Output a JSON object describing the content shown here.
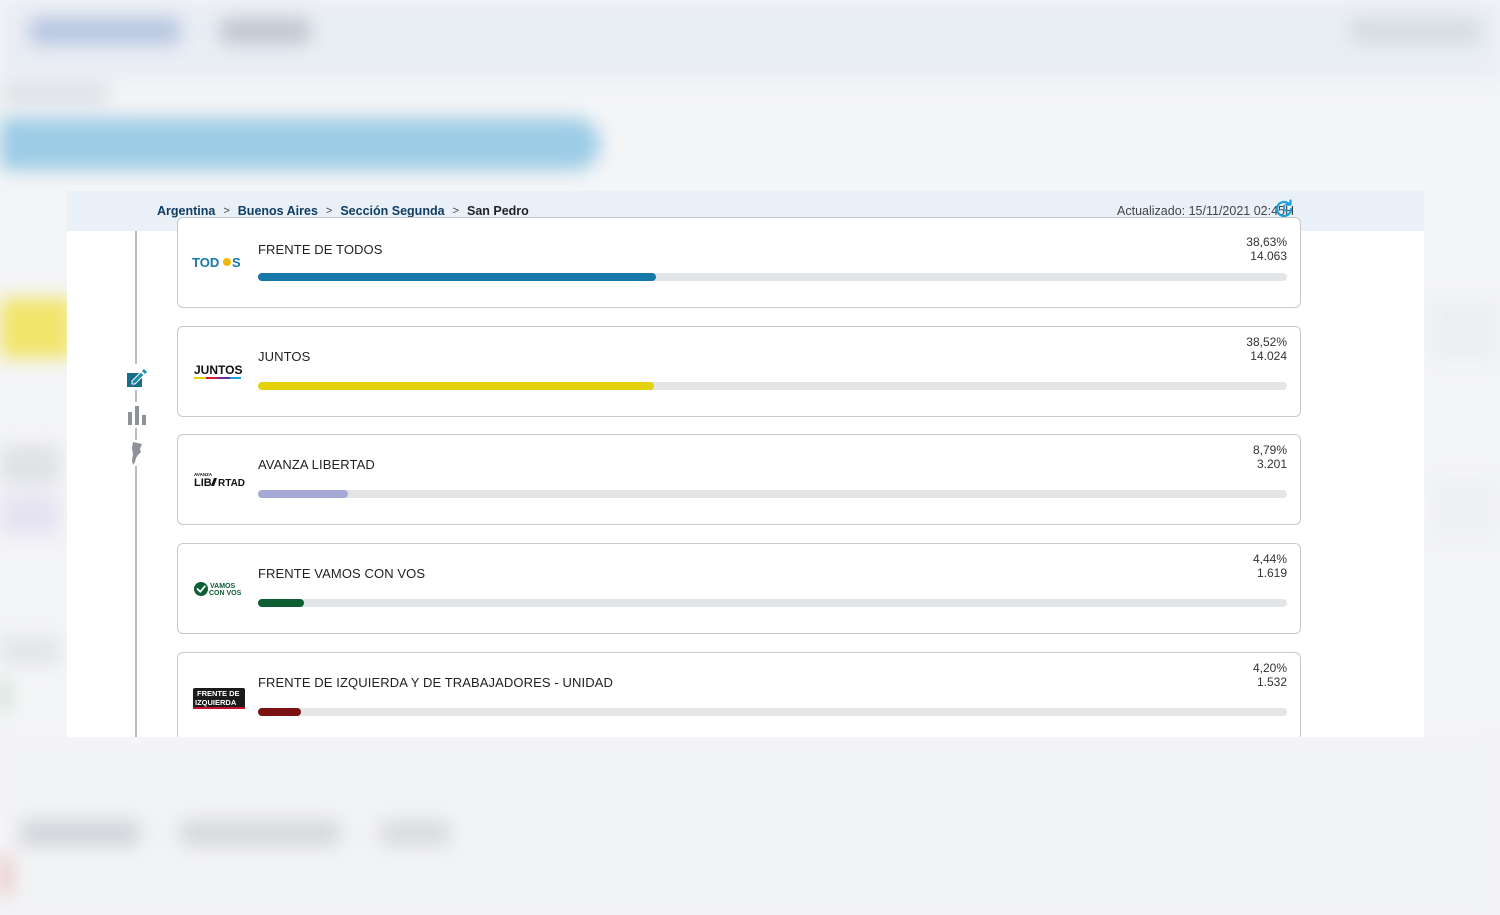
{
  "breadcrumb": {
    "items": [
      "Argentina",
      "Buenos Aires",
      "Sección Segunda"
    ],
    "current": "San Pedro",
    "separator": ">"
  },
  "updated": "Actualizado: 15/11/2021 02:45H",
  "colors": {
    "link": "#0f3d63",
    "accent": "#1aa0d8",
    "track": "#e4e5e7"
  },
  "side_icons": [
    "ballot-edit-icon",
    "bar-chart-icon",
    "map-argentina-icon"
  ],
  "results": [
    {
      "party": "FRENTE DE TODOS",
      "percent": "38,63%",
      "votes": "14.063",
      "share": 38.63,
      "color": "#1677a8",
      "logo": "TODOS"
    },
    {
      "party": "JUNTOS",
      "percent": "38,52%",
      "votes": "14.024",
      "share": 38.52,
      "color": "#e2d10b",
      "logo": "JUNTOS"
    },
    {
      "party": "AVANZA LIBERTAD",
      "percent": "8,79%",
      "votes": "3.201",
      "share": 8.79,
      "color": "#a6a8d6",
      "logo": "AVANZA LIBERTAD"
    },
    {
      "party": "FRENTE VAMOS CON VOS",
      "percent": "4,44%",
      "votes": "1.619",
      "share": 4.44,
      "color": "#0e5d33",
      "logo": "VAMOS CON VOS"
    },
    {
      "party": "FRENTE DE IZQUIERDA Y DE TRABAJADORES - UNIDAD",
      "percent": "4,20%",
      "votes": "1.532",
      "share": 4.2,
      "color": "#7b1113",
      "logo": "FRENTE DE IZQUIERDA"
    }
  ]
}
